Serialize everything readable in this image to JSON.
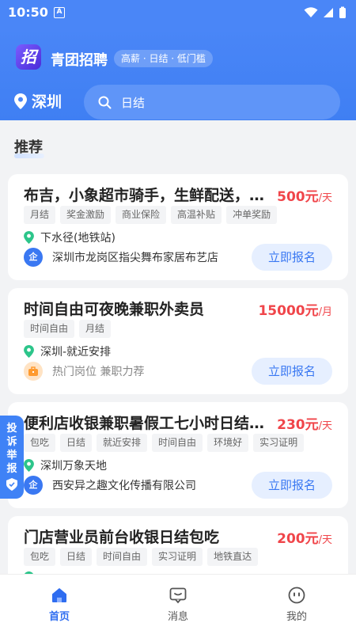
{
  "status": {
    "time": "10:50",
    "notif_icon": "A"
  },
  "header": {
    "logo_char": "招",
    "app_name": "青团招聘",
    "slogan": "高薪 · 日结 · 低门槛",
    "city": "深圳",
    "search_text": "日结"
  },
  "section": {
    "title": "推荐"
  },
  "jobs": [
    {
      "title": "布吉，小象超市骑手，生鲜配送，包吃住",
      "salary": "500元",
      "unit": "/天",
      "tags": [
        "月结",
        "奖金激励",
        "商业保险",
        "高温补贴",
        "冲单奖励"
      ],
      "location": "下水径(地铁站)",
      "company": "深圳市龙岗区指尖舞布家居布艺店",
      "apply": "立即报名"
    },
    {
      "title": "时间自由可夜晚兼职外卖员",
      "salary": "15000元",
      "unit": "/月",
      "tags": [
        "时间自由",
        "月结"
      ],
      "location": "深圳-就近安排",
      "company": "热门岗位 兼职力荐",
      "apply": "立即报名"
    },
    {
      "title": "便利店收银兼职暑假工七小时日结兼职",
      "salary": "230元",
      "unit": "/天",
      "tags": [
        "包吃",
        "日结",
        "就近安排",
        "时间自由",
        "环境好",
        "实习证明"
      ],
      "location": "深圳万象天地",
      "company": "西安异之趣文化传播有限公司",
      "apply": "立即报名"
    },
    {
      "title": "门店营业员前台收银日结包吃",
      "salary": "200元",
      "unit": "/天",
      "tags": [
        "包吃",
        "日结",
        "时间自由",
        "实习证明",
        "地铁直达"
      ],
      "location": "",
      "company": "",
      "apply": ""
    }
  ],
  "company_badge": "企",
  "report": {
    "chars": [
      "投",
      "诉",
      "举",
      "报"
    ]
  },
  "nav": [
    {
      "label": "首页",
      "icon": "home-icon",
      "active": true
    },
    {
      "label": "消息",
      "icon": "message-icon",
      "active": false
    },
    {
      "label": "我的",
      "icon": "profile-icon",
      "active": false
    }
  ],
  "colors": {
    "primary": "#4a86f7",
    "salary": "#f0454a",
    "location": "#2cc58a",
    "button_bg": "#e6efff"
  }
}
